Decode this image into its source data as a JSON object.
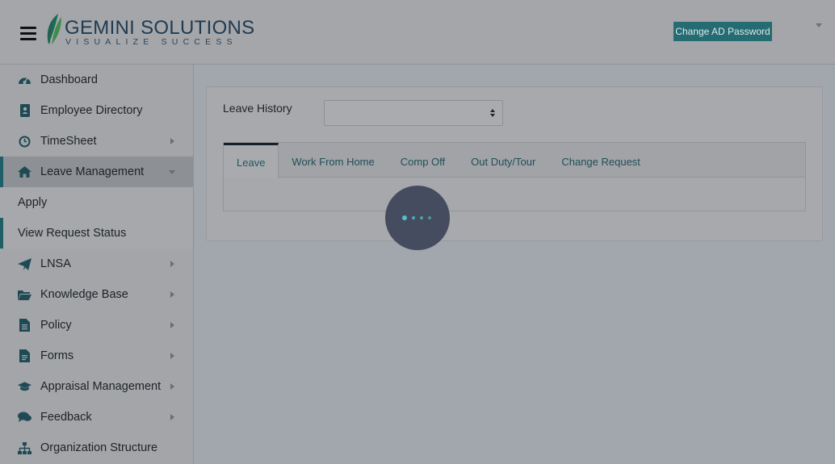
{
  "header": {
    "logo_name": "GEMINI SOLUTIONS",
    "logo_tagline": "VISUALIZE SUCCESS",
    "change_password_label": "Change AD Password"
  },
  "sidebar": {
    "items": [
      {
        "label": "Dashboard",
        "icon": "dashboard-icon"
      },
      {
        "label": "Employee Directory",
        "icon": "address-book-icon"
      },
      {
        "label": "TimeSheet",
        "icon": "clock-icon"
      },
      {
        "label": "Leave Management",
        "icon": "home-icon"
      },
      {
        "label": "LNSA",
        "icon": "paper-plane-icon"
      },
      {
        "label": "Knowledge Base",
        "icon": "folder-icon"
      },
      {
        "label": "Policy",
        "icon": "document-icon"
      },
      {
        "label": "Forms",
        "icon": "form-icon"
      },
      {
        "label": "Appraisal Management",
        "icon": "graduation-cap-icon"
      },
      {
        "label": "Feedback",
        "icon": "comments-icon"
      },
      {
        "label": "Organization Structure",
        "icon": "sitemap-icon"
      }
    ],
    "sub_items": [
      {
        "label": "Apply"
      },
      {
        "label": "View Request Status"
      }
    ]
  },
  "main": {
    "leave_history_label": "Leave History",
    "leave_history_value": "",
    "tabs": [
      {
        "label": "Leave"
      },
      {
        "label": "Work From Home"
      },
      {
        "label": "Comp Off"
      },
      {
        "label": "Out Duty/Tour"
      },
      {
        "label": "Change Request"
      }
    ]
  },
  "colors": {
    "accent": "#246b72",
    "loader_dot": "#4fc3cf"
  }
}
